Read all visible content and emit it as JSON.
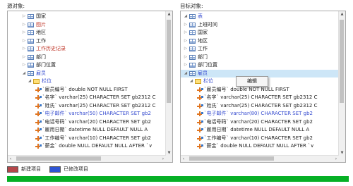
{
  "source": {
    "label": "源对象:",
    "items": [
      {
        "label": "国家",
        "type": "table",
        "color": "normal",
        "expander": "right"
      },
      {
        "label": "图片",
        "type": "table",
        "color": "red",
        "expander": "right"
      },
      {
        "label": "地区",
        "type": "table",
        "color": "normal",
        "expander": "right"
      },
      {
        "label": "工作",
        "type": "table",
        "color": "normal",
        "expander": "right"
      },
      {
        "label": "工作历史记录",
        "type": "table",
        "color": "red",
        "expander": "right"
      },
      {
        "label": "部门",
        "type": "table",
        "color": "normal",
        "expander": "right"
      },
      {
        "label": "部门位置",
        "type": "table",
        "color": "normal",
        "expander": "right"
      },
      {
        "label": "雇员",
        "type": "table",
        "color": "blue",
        "expander": "down"
      },
      {
        "label": "栏位",
        "type": "folder",
        "color": "blue",
        "expander": "down"
      },
      {
        "label": "`雇员编号` double NOT NULL FIRST",
        "type": "field",
        "color": "normal"
      },
      {
        "label": "`名字` varchar(25) CHARACTER SET gb2312 C",
        "type": "field",
        "color": "normal"
      },
      {
        "label": "`姓氏` varchar(25) CHARACTER SET gb2312 C",
        "type": "field",
        "color": "normal"
      },
      {
        "label": "`电子邮件` varchar(50) CHARACTER SET gb2",
        "type": "field",
        "color": "blue"
      },
      {
        "label": "`电话号码` varchar(20) CHARACTER SET gb2",
        "type": "field",
        "color": "normal"
      },
      {
        "label": "`雇用日期` datetime NULL DEFAULT NULL A",
        "type": "field",
        "color": "normal"
      },
      {
        "label": "`工作编号` varchar(10) CHARACTER SET gb2",
        "type": "field",
        "color": "normal"
      },
      {
        "label": "`薪金` double NULL DEFAULT NULL AFTER `∨",
        "type": "field",
        "color": "normal"
      }
    ]
  },
  "target": {
    "label": "目标对象:",
    "items": [
      {
        "label": "表",
        "type": "table",
        "color": "blue",
        "expander": "down"
      },
      {
        "label": "上班时间",
        "type": "table",
        "color": "normal",
        "expander": "right"
      },
      {
        "label": "国家",
        "type": "table",
        "color": "normal",
        "expander": "right"
      },
      {
        "label": "地区",
        "type": "table",
        "color": "normal",
        "expander": "right"
      },
      {
        "label": "工作",
        "type": "table",
        "color": "normal",
        "expander": "right"
      },
      {
        "label": "部门",
        "type": "table",
        "color": "normal",
        "expander": "right"
      },
      {
        "label": "部门位置",
        "type": "table",
        "color": "normal",
        "expander": "right"
      },
      {
        "label": "雇员",
        "type": "table",
        "color": "blue",
        "expander": "down",
        "selected": true
      },
      {
        "label": "栏位",
        "type": "folder",
        "color": "blue",
        "expander": "down"
      },
      {
        "label": "`雇员编号` double NOT NULL FIRST",
        "type": "field",
        "color": "normal"
      },
      {
        "label": "`名字` varchar(25) CHARACTER SET gb2312 C",
        "type": "field",
        "color": "normal"
      },
      {
        "label": "`姓氏` varchar(25) CHARACTER SET gb2312 C",
        "type": "field",
        "color": "normal"
      },
      {
        "label": "`电子邮件` varchar(80) CHARACTER SET gb2",
        "type": "field",
        "color": "blue"
      },
      {
        "label": "`电话号码` varchar(20) CHARACTER SET gb2",
        "type": "field",
        "color": "normal"
      },
      {
        "label": "`雇用日期` datetime NULL DEFAULT NULL A",
        "type": "field",
        "color": "normal"
      },
      {
        "label": "`工作编号` varchar(10) CHARACTER SET gb2",
        "type": "field",
        "color": "normal"
      },
      {
        "label": "`薪金` double NULL DEFAULT NULL AFTER `∨",
        "type": "field",
        "color": "normal"
      }
    ]
  },
  "context_menu": {
    "edit_label": "编辑"
  },
  "legend": {
    "new_label": "新建项目",
    "new_color": "#b5474a",
    "modified_label": "已修改项目",
    "modified_color": "#2f55d4"
  },
  "progress": {
    "fraction": 1.0,
    "color": "#06b025"
  },
  "colors": {
    "red_text": "#c0392b",
    "blue_text": "#3a4fd0",
    "selection": "#cde6f7"
  }
}
